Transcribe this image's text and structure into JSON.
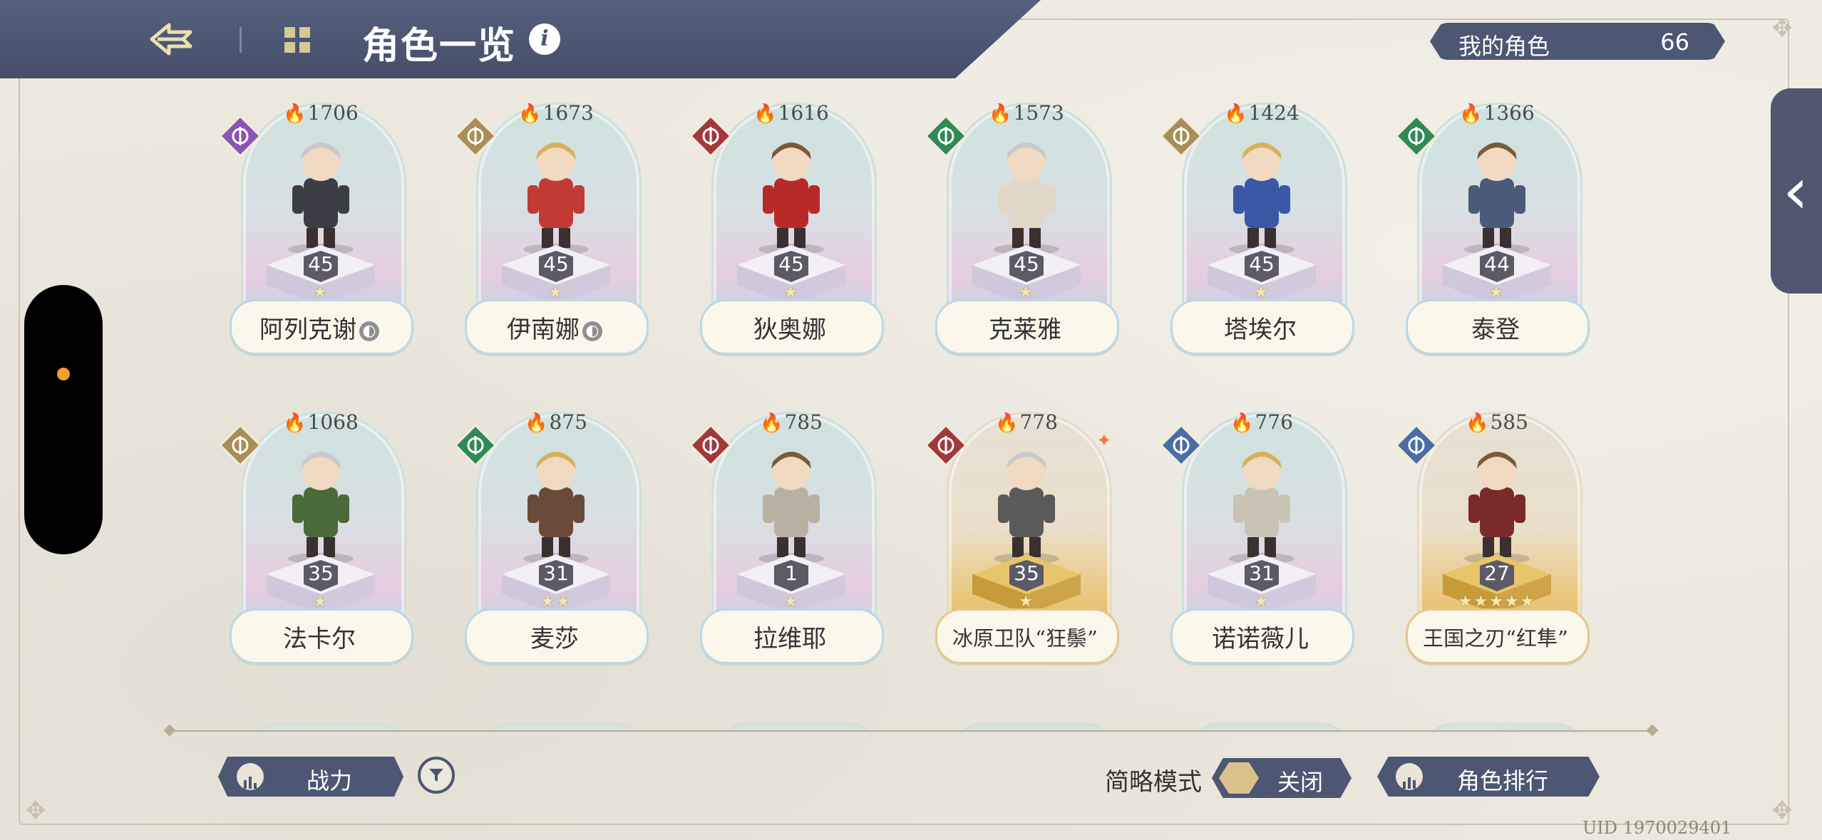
{
  "header": {
    "title": "角色一览",
    "back_icon": "back-arrow-icon",
    "menu_icon": "grid-menu-icon",
    "info_label": "i"
  },
  "my_characters": {
    "label": "我的角色",
    "count": "66"
  },
  "colors": {
    "header_bg": "#4f5976",
    "accent_flame": "#e8742a",
    "class_purple": "#8a55b3",
    "class_gold": "#a98e5a",
    "class_red": "#a1383c",
    "class_green": "#2f8a55",
    "class_blue": "#4a6da6"
  },
  "characters": [
    {
      "name": "阿列克谢",
      "power": "1706",
      "level": "45",
      "stars": "★",
      "class": "purple",
      "badge": true,
      "gold": false
    },
    {
      "name": "伊南娜",
      "power": "1673",
      "level": "45",
      "stars": "★",
      "class": "gold",
      "badge": true,
      "gold": false
    },
    {
      "name": "狄奥娜",
      "power": "1616",
      "level": "45",
      "stars": "★",
      "class": "red",
      "badge": false,
      "gold": false
    },
    {
      "name": "克莱雅",
      "power": "1573",
      "level": "45",
      "stars": "★",
      "class": "green",
      "badge": false,
      "gold": false
    },
    {
      "name": "塔埃尔",
      "power": "1424",
      "level": "45",
      "stars": "★",
      "class": "gold",
      "badge": false,
      "gold": false
    },
    {
      "name": "泰登",
      "power": "1366",
      "level": "44",
      "stars": "★",
      "class": "green",
      "badge": false,
      "gold": false
    },
    {
      "name": "法卡尔",
      "power": "1068",
      "level": "35",
      "stars": "★",
      "class": "gold",
      "badge": false,
      "gold": false
    },
    {
      "name": "麦莎",
      "power": "875",
      "level": "31",
      "stars": "★★",
      "class": "green",
      "badge": false,
      "gold": false
    },
    {
      "name": "拉维耶",
      "power": "785",
      "level": "1",
      "stars": "★",
      "class": "red",
      "badge": false,
      "gold": false
    },
    {
      "name": "冰原卫队“狂鬃”",
      "power": "778",
      "level": "35",
      "stars": "★",
      "class": "red",
      "badge": false,
      "gold": true
    },
    {
      "name": "诺诺薇儿",
      "power": "776",
      "level": "31",
      "stars": "★",
      "class": "blue",
      "badge": false,
      "gold": false
    },
    {
      "name": "王国之刃“红隼”",
      "power": "585",
      "level": "27",
      "stars": "★★★★★",
      "class": "blue",
      "badge": false,
      "gold": true
    }
  ],
  "bottom": {
    "power_sort_label": "战力",
    "simple_mode_label": "简略模式",
    "simple_mode_state": "关闭",
    "ranking_label": "角色排行"
  },
  "uid": "UID 1970029401"
}
